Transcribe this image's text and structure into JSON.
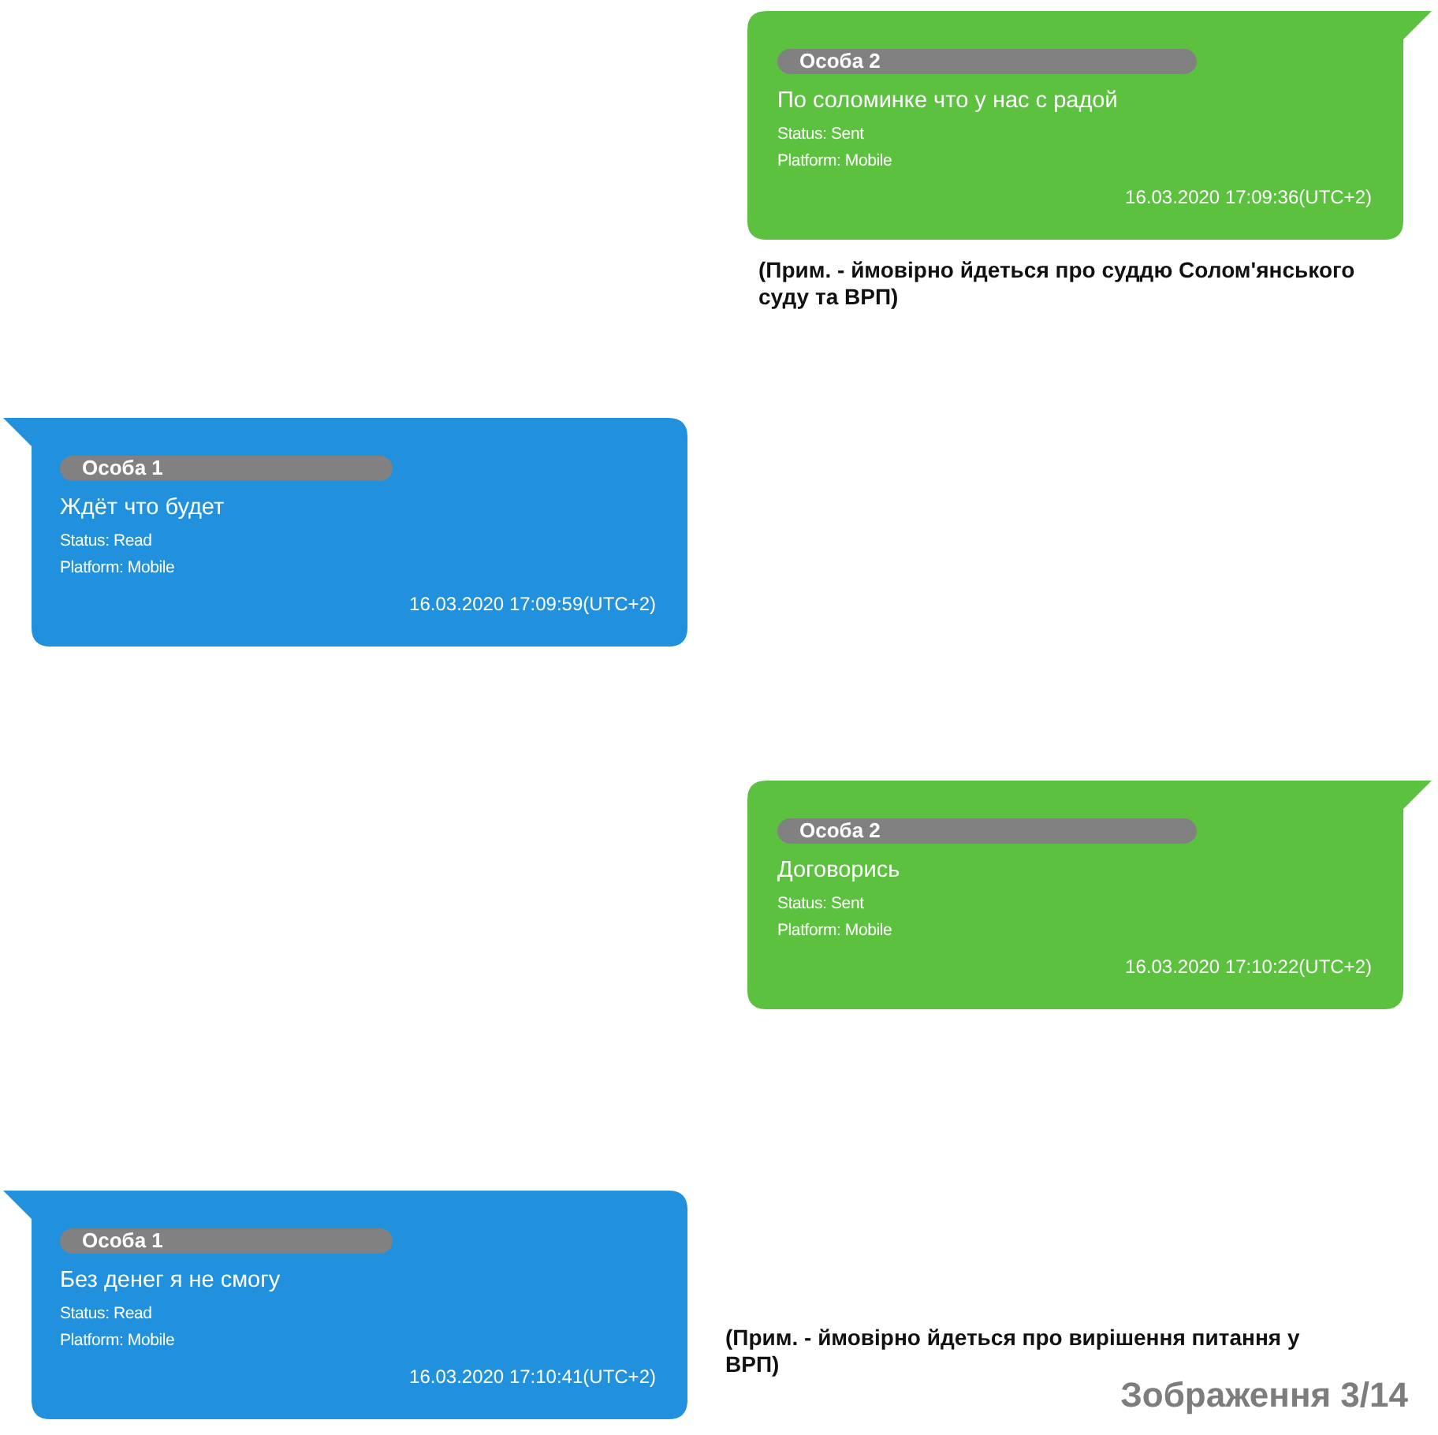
{
  "messages": [
    {
      "kind": "outgoing",
      "sender": "Особа 2",
      "text": "По соломинке что у нас с радой",
      "status": "Status: Sent",
      "platform": "Platform: Mobile",
      "timestamp": "16.03.2020 17:09:36(UTC+2)",
      "note": "(Прим. - ймовірно йдеться про суддю Солом'янського суду та ВРП)"
    },
    {
      "kind": "incoming",
      "sender": "Особа 1",
      "text": "Ждёт что будет",
      "status": "Status: Read",
      "platform": "Platform: Mobile",
      "timestamp": "16.03.2020 17:09:59(UTC+2)"
    },
    {
      "kind": "outgoing",
      "sender": "Особа 2",
      "text": "Договорись",
      "status": "Status: Sent",
      "platform": "Platform: Mobile",
      "timestamp": "16.03.2020 17:10:22(UTC+2)"
    },
    {
      "kind": "incoming",
      "sender": "Особа 1",
      "text": "Без денег я не смогу",
      "status": "Status: Read",
      "platform": "Platform: Mobile",
      "timestamp": "16.03.2020 17:10:41(UTC+2)",
      "note": "(Прим. - ймовірно йдеться про вирішення питання у ВРП)"
    }
  ],
  "caption": "Зображення 3/14"
}
